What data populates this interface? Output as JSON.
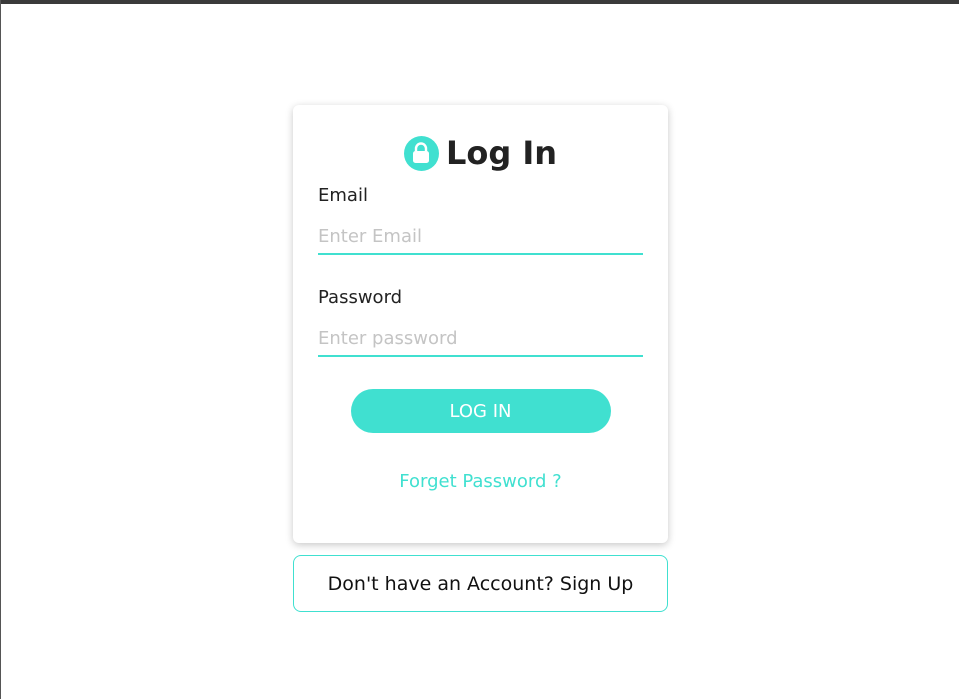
{
  "colors": {
    "accent": "#40e0d0",
    "text": "#222222",
    "placeholder": "#c4c4c4",
    "background": "#ffffff"
  },
  "login": {
    "icon": "lock-icon",
    "title": "Log In",
    "email_label": "Email",
    "email_placeholder": "Enter Email",
    "email_value": "",
    "password_label": "Password",
    "password_placeholder": "Enter password",
    "password_value": "",
    "submit_label": "LOG IN",
    "forgot_label": "Forget Password ?"
  },
  "signup": {
    "label": "Don't have an Account? Sign Up"
  }
}
